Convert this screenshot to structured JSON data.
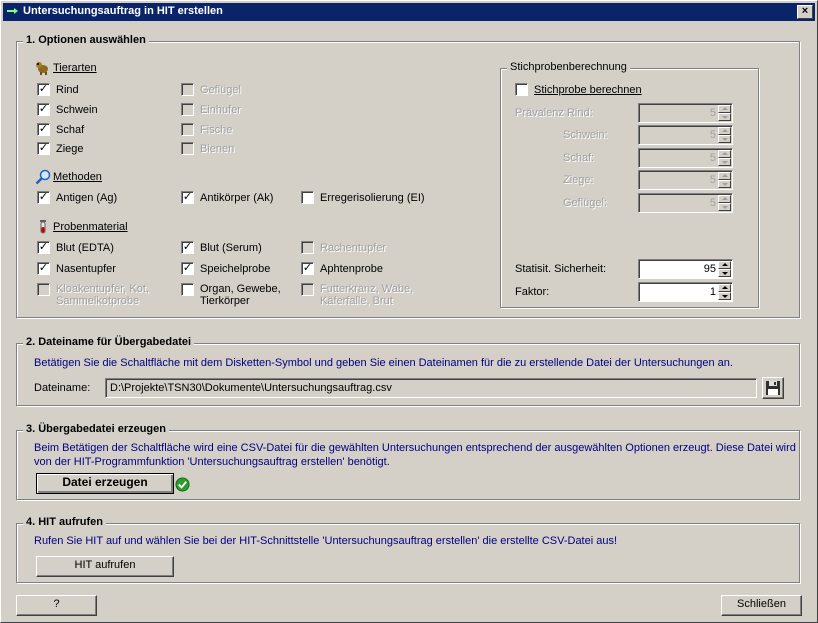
{
  "window": {
    "title": "Untersuchungsauftrag in HIT erstellen",
    "close_label": "×"
  },
  "section1": {
    "title": "1. Optionen auswählen",
    "tierarten": {
      "label": "Tierarten",
      "items": [
        {
          "label": "Rind",
          "checked": true,
          "enabled": true
        },
        {
          "label": "Schwein",
          "checked": true,
          "enabled": true
        },
        {
          "label": "Schaf",
          "checked": true,
          "enabled": true
        },
        {
          "label": "Ziege",
          "checked": true,
          "enabled": true
        },
        {
          "label": "Geflügel",
          "checked": false,
          "enabled": false
        },
        {
          "label": "Einhufer",
          "checked": false,
          "enabled": false
        },
        {
          "label": "Fische",
          "checked": false,
          "enabled": false
        },
        {
          "label": "Bienen",
          "checked": false,
          "enabled": false
        }
      ]
    },
    "methoden": {
      "label": "Methoden",
      "items": [
        {
          "label": "Antigen (Ag)",
          "checked": true,
          "enabled": true
        },
        {
          "label": "Antikörper (Ak)",
          "checked": true,
          "enabled": true
        },
        {
          "label": "Erregerisolierung (EI)",
          "checked": false,
          "enabled": true
        }
      ]
    },
    "probenmaterial": {
      "label": "Probenmaterial",
      "items": [
        {
          "label": "Blut (EDTA)",
          "checked": true,
          "enabled": true
        },
        {
          "label": "Blut (Serum)",
          "checked": true,
          "enabled": true
        },
        {
          "label": "Rachentupfer",
          "checked": false,
          "enabled": false
        },
        {
          "label": "Nasentupfer",
          "checked": true,
          "enabled": true
        },
        {
          "label": "Speichelprobe",
          "checked": true,
          "enabled": true
        },
        {
          "label": "Aphtenprobe",
          "checked": true,
          "enabled": true
        },
        {
          "label_line1": "Kloakentupfer, Kot,",
          "label_line2": "Sammelkotprobe",
          "checked": false,
          "enabled": false
        },
        {
          "label_line1": "Organ, Gewebe,",
          "label_line2": "Tierkörper",
          "checked": false,
          "enabled": true
        },
        {
          "label_line1": "Futterkranz, Wabe,",
          "label_line2": "Käferfalle, Brut",
          "checked": false,
          "enabled": false
        }
      ]
    },
    "stichprobe": {
      "title": "Stichprobenberechnung",
      "checkbox_label": "Stichprobe berechnen",
      "checked": false,
      "praevalenz_label": "Prävalenz Rind:",
      "rows": [
        {
          "label": "Prävalenz Rind:",
          "value": "5"
        },
        {
          "label": "Schwein:",
          "value": "5"
        },
        {
          "label": "Schaf:",
          "value": "5"
        },
        {
          "label": "Ziege:",
          "value": "5"
        },
        {
          "label": "Geflügel:",
          "value": "5"
        }
      ],
      "sicherheit_label": "Statisit. Sicherheit:",
      "sicherheit_value": "95",
      "faktor_label": "Faktor:",
      "faktor_value": "1"
    }
  },
  "section2": {
    "title": "2. Dateiname für Übergabedatei",
    "instruction": "Betätigen Sie die Schaltfläche mit dem Disketten-Symbol und geben Sie einen Dateinamen für die zu erstellende Datei der Untersuchungen an.",
    "filename_label": "Dateiname:",
    "filename_value": "D:\\Projekte\\TSN30\\Dokumente\\Untersuchungsauftrag.csv"
  },
  "section3": {
    "title": "3. Übergabedatei erzeugen",
    "instruction_line1": "Beim Betätigen der Schaltfläche wird eine CSV-Datei für die gewählten Untersuchungen entsprechend der ausgewählten Optionen erzeugt. Diese Datei wird",
    "instruction_line2": "von der HIT-Programmfunktion 'Untersuchungsauftrag erstellen' benötigt.",
    "button_label": "Datei erzeugen"
  },
  "section4": {
    "title": "4. HIT aufrufen",
    "instruction": "Rufen Sie HIT auf und wählen Sie bei der HIT-Schnittstelle 'Untersuchungsauftrag erstellen' die erstellte CSV-Datei aus!",
    "button_label": "HIT aufrufen"
  },
  "footer": {
    "help_label": "?",
    "close_label": "Schließen"
  },
  "colors": {
    "titlebar": "#0a246a",
    "face": "#d4d0c8",
    "instruction_text": "#000080",
    "check_ok": "#2a9d2a"
  }
}
